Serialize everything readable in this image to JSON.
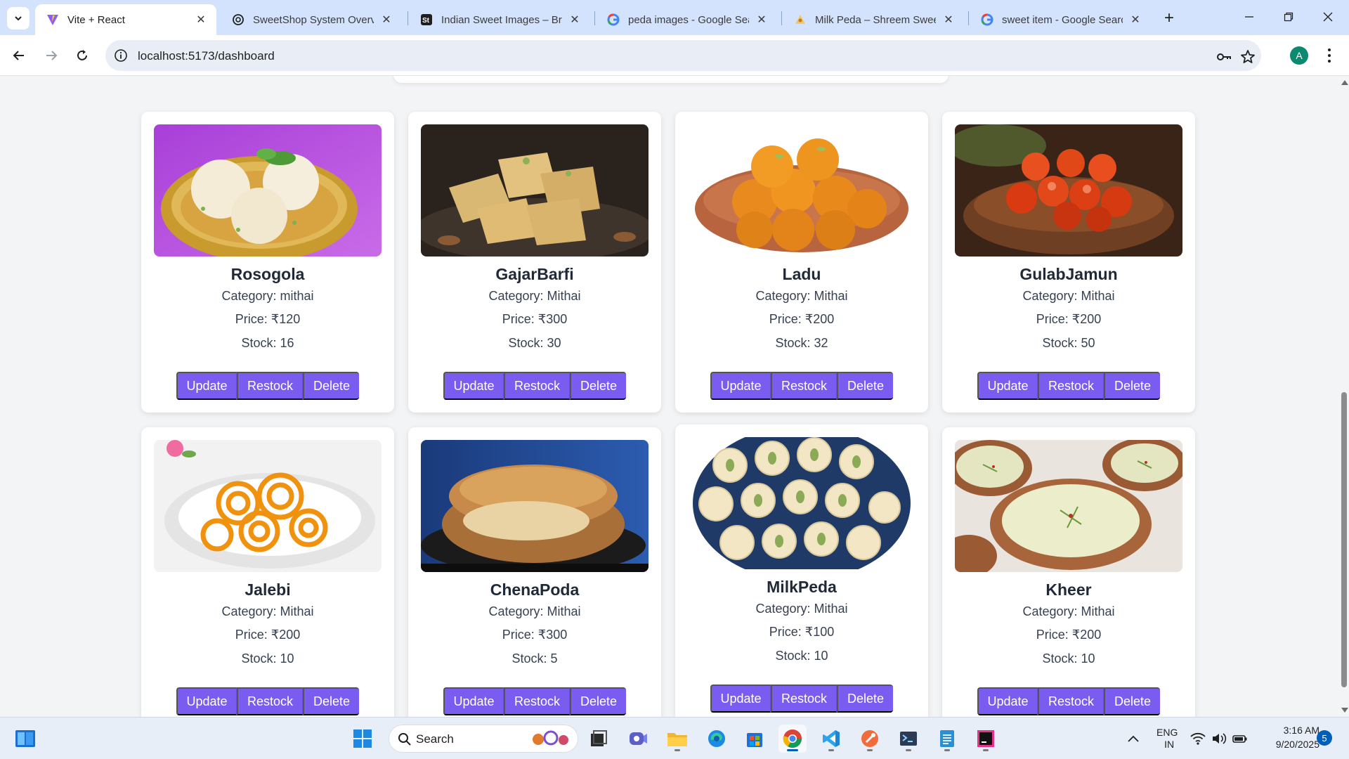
{
  "browser": {
    "tabs": [
      {
        "title": "Vite + React",
        "active": true,
        "icon": "vite-icon"
      },
      {
        "title": "SweetShop System Overvie",
        "active": false,
        "icon": "chatgpt-icon"
      },
      {
        "title": "Indian Sweet Images – Bro",
        "active": false,
        "icon": "shutterstock-icon"
      },
      {
        "title": "peda images - Google Sea",
        "active": false,
        "icon": "google-icon"
      },
      {
        "title": "Milk Peda – Shreem Sweet",
        "active": false,
        "icon": "shreem-icon"
      },
      {
        "title": "sweet item - Google Searc",
        "active": false,
        "icon": "google-icon"
      }
    ],
    "url": "localhost:5173/dashboard",
    "profile_initial": "A"
  },
  "sweets": [
    {
      "name": "Rosogola",
      "category": "Category: mithai",
      "price": "Price: ₹120",
      "stock": "Stock: 16"
    },
    {
      "name": "GajarBarfi",
      "category": "Category: Mithai",
      "price": "Price: ₹300",
      "stock": "Stock: 30"
    },
    {
      "name": "Ladu",
      "category": "Category: Mithai",
      "price": "Price: ₹200",
      "stock": "Stock: 32"
    },
    {
      "name": "GulabJamun",
      "category": "Category: Mithai",
      "price": "Price: ₹200",
      "stock": "Stock: 50"
    },
    {
      "name": "Jalebi",
      "category": "Category: Mithai",
      "price": "Price: ₹200",
      "stock": "Stock: 10"
    },
    {
      "name": "ChenaPoda",
      "category": "Category: Mithai",
      "price": "Price: ₹300",
      "stock": "Stock: 5"
    },
    {
      "name": "MilkPeda",
      "category": "Category: Mithai",
      "price": "Price: ₹100",
      "stock": "Stock: 10"
    },
    {
      "name": "Kheer",
      "category": "Category: Mithai",
      "price": "Price: ₹200",
      "stock": "Stock: 10"
    }
  ],
  "card_actions": {
    "update": "Update",
    "restock": "Restock",
    "delete": "Delete"
  },
  "colors": {
    "accent": "#7b5cf0",
    "page_bg": "#f3f4f6",
    "tab_strip": "#d3e3fd"
  },
  "taskbar": {
    "search_placeholder": "Search",
    "lang_top": "ENG",
    "lang_bottom": "IN",
    "time": "3:16 AM",
    "date": "9/20/2025",
    "notification_count": "5",
    "apps": [
      "windows-start-icon",
      "search-icon",
      "task-view-icon",
      "meet-icon",
      "file-explorer-icon",
      "edge-icon",
      "store-icon",
      "chrome-icon",
      "vscode-icon",
      "postman-icon",
      "terminal-icon",
      "notepad-icon",
      "jetbrains-icon"
    ]
  }
}
